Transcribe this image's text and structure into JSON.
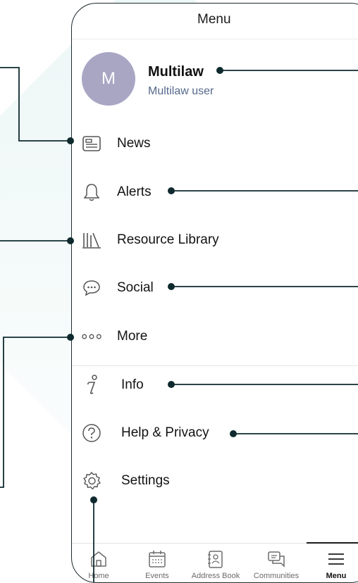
{
  "header": {
    "title": "Menu"
  },
  "profile": {
    "initial": "M",
    "name": "Multilaw",
    "role": "Multilaw user"
  },
  "menu": {
    "items": [
      {
        "label": "News",
        "icon": "news-icon"
      },
      {
        "label": "Alerts",
        "icon": "bell-icon"
      },
      {
        "label": "Resource Library",
        "icon": "library-icon"
      },
      {
        "label": "Social",
        "icon": "chat-bubble-icon"
      },
      {
        "label": "More",
        "icon": "more-dots-icon"
      }
    ],
    "secondary": [
      {
        "label": "Info",
        "icon": "info-icon"
      },
      {
        "label": "Help & Privacy",
        "icon": "question-icon"
      },
      {
        "label": "Settings",
        "icon": "gear-icon"
      }
    ]
  },
  "tabbar": {
    "tabs": [
      {
        "label": "Home",
        "icon": "home-icon"
      },
      {
        "label": "Events",
        "icon": "calendar-icon"
      },
      {
        "label": "Address Book",
        "icon": "address-book-icon"
      },
      {
        "label": "Communities",
        "icon": "communities-icon"
      },
      {
        "label": "Menu",
        "icon": "menu-icon",
        "active": true
      }
    ]
  },
  "colors": {
    "avatar": "#a9a6c4",
    "accent": "#0e2a2e",
    "role_text": "#556a8c"
  }
}
